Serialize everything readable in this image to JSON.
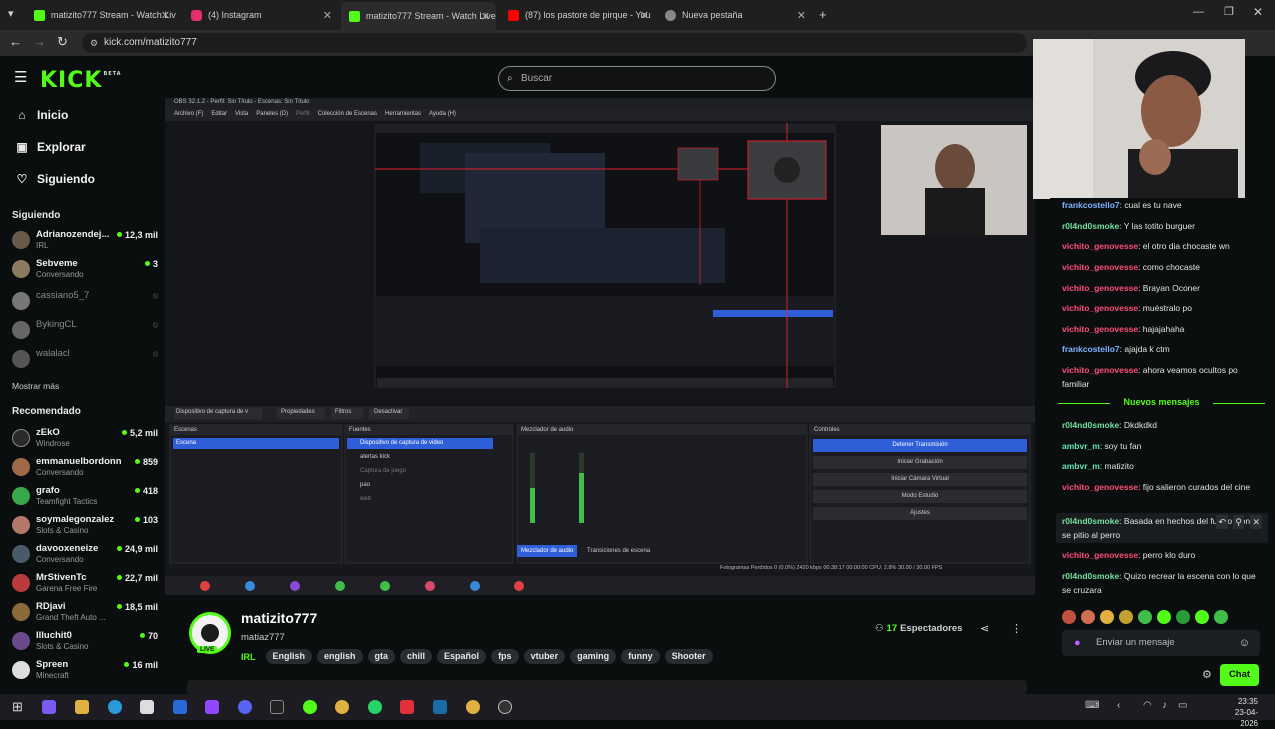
{
  "browser": {
    "tabs": [
      {
        "title": "matizito777 Stream - Watch Live",
        "fav": "#53fc18",
        "icon": "kick-icon"
      },
      {
        "title": "(4) Instagram",
        "fav": "#e1306c",
        "icon": "instagram-icon"
      },
      {
        "title": "matizito777 Stream - Watch Live",
        "fav": "#53fc18",
        "icon": "kick-icon"
      },
      {
        "title": "(87) los pastore de pirque - You",
        "fav": "#ff0000",
        "icon": "youtube-icon"
      },
      {
        "title": "Nueva pestaña",
        "fav": "#888888",
        "icon": "chrome-icon"
      }
    ],
    "url": "kick.com/matizito777"
  },
  "header": {
    "logo": "KICK",
    "logo_badge": "BETA",
    "search_placeholder": "Buscar"
  },
  "sidebar": {
    "nav": [
      {
        "label": "Inicio",
        "icon": "home-icon",
        "glyph": "⌂"
      },
      {
        "label": "Explorar",
        "icon": "compass-icon",
        "glyph": "▣"
      },
      {
        "label": "Siguiendo",
        "icon": "heart-icon",
        "glyph": "♡"
      }
    ],
    "following_title": "Siguiendo",
    "following": [
      {
        "name": "Adrianozendej...",
        "sub": "IRL",
        "viewers": "12,3 mil",
        "live": true
      },
      {
        "name": "Sebveme",
        "sub": "Conversando",
        "viewers": "3",
        "live": true
      },
      {
        "name": "cassiano5_7",
        "sub": "",
        "viewers": "",
        "live": false
      },
      {
        "name": "BykingCL",
        "sub": "",
        "viewers": "",
        "live": false
      },
      {
        "name": "walalacl",
        "sub": "",
        "viewers": "",
        "live": false
      }
    ],
    "show_more": "Mostrar más",
    "recommended_title": "Recomendado",
    "recommended": [
      {
        "name": "zEkO",
        "sub": "Windrose",
        "viewers": "5,2 mil"
      },
      {
        "name": "emmanuelbordonn",
        "sub": "Conversando",
        "viewers": "859"
      },
      {
        "name": "grafo",
        "sub": "Teamfight Tactics",
        "viewers": "418"
      },
      {
        "name": "soymalegonzalez",
        "sub": "Slots & Casino",
        "viewers": "103"
      },
      {
        "name": "davooxeneize",
        "sub": "Conversando",
        "viewers": "24,9 mil"
      },
      {
        "name": "MrStivenTc",
        "sub": "Garena Free Fire",
        "viewers": "22,7 mil"
      },
      {
        "name": "RDjavi",
        "sub": "Grand Theft Auto ...",
        "viewers": "18,5 mil"
      },
      {
        "name": "Illuchit0",
        "sub": "Slots & Casino",
        "viewers": "70"
      },
      {
        "name": "Spreen",
        "sub": "Minecraft",
        "viewers": "16 mil"
      }
    ]
  },
  "stream": {
    "obs_title": "OBS 32.1.2 - Perfil: Sin Título - Escenas: Sin Título",
    "obs_menu": [
      "Archivo (F)",
      "Editar",
      "Vista",
      "Paneles (D)",
      "Perfil",
      "Colección de Escenas",
      "Herramientas",
      "Ayuda (H)"
    ],
    "source_bar": [
      "Dispositivo de captura de v",
      "Propiedades",
      "Filtros",
      "Desactivar"
    ],
    "panels": {
      "scenes_title": "Escenas",
      "scenes": [
        "Escena"
      ],
      "sources_title": "Fuentes",
      "sources": [
        "Dispositivo de captura de video",
        "alertas kick",
        "Captura de juego",
        "pao",
        "web"
      ],
      "mixer_title": "Mezclador de audio",
      "mixer_tabs": [
        "Mezclador de audio",
        "Transiciones de escena"
      ],
      "controls_title": "Controles",
      "controls": [
        "Detener Transmisión",
        "Iniciar Grabación",
        "Iniciar Cámara Virtual",
        "Modo Estudio",
        "Ajustes"
      ]
    },
    "status": "Fotogramas Perdidos 0 (0.0%)   2420 kbps   00:38:17   00:00:00   CPU: 2.8%   30.00 / 30.00 FPS"
  },
  "streamer": {
    "name": "matizito777",
    "handle": "matiaz777",
    "live_badge": "LIVE",
    "category": "IRL",
    "tags": [
      "English",
      "english",
      "gta",
      "chill",
      "Español",
      "fps",
      "vtuber",
      "gaming",
      "funny",
      "Shooter"
    ],
    "viewers_count": "17",
    "viewers_label": "Espectadores"
  },
  "chat": {
    "messages": [
      {
        "user": "frankcostello7",
        "cls": "ufc",
        "text": "cual es tu nave"
      },
      {
        "user": "r0l4nd0smoke",
        "cls": "ur0",
        "text": "Y las totito burguer"
      },
      {
        "user": "vichito_genovesse",
        "cls": "uvg",
        "text": "el otro dia chocaste wn"
      },
      {
        "user": "vichito_genovesse",
        "cls": "uvg",
        "text": "como chocaste"
      },
      {
        "user": "vichito_genovesse",
        "cls": "uvg",
        "text": "Brayan Oconer"
      },
      {
        "user": "vichito_genovesse",
        "cls": "uvg",
        "text": "muéstralo po"
      },
      {
        "user": "vichito_genovesse",
        "cls": "uvg",
        "text": "hajajahaha"
      },
      {
        "user": "frankcostello7",
        "cls": "ufc",
        "text": "ajajda k ctm"
      },
      {
        "user": "vichito_genovesse",
        "cls": "uvg",
        "text": "ahora veamos ocultos po familiar"
      }
    ],
    "new_messages_label": "Nuevos mensajes",
    "new_messages": [
      {
        "user": "r0l4nd0smoke",
        "cls": "ur0",
        "text": "Dkdkdkd"
      },
      {
        "user": "ambvr_m",
        "cls": "uam",
        "text": "soy tu fan"
      },
      {
        "user": "ambvr_m",
        "cls": "uam",
        "text": "matizito"
      },
      {
        "user": "vichito_genovesse",
        "cls": "uvg",
        "text": "fijo salieron curados del cine"
      },
      {
        "user": "r0l4nd0smoke",
        "cls": "ur0",
        "text": "Basada en hechos del futuro won q se pitio al perro"
      },
      {
        "user": "vichito_genovesse",
        "cls": "uvg",
        "text": "perro klo duro"
      },
      {
        "user": "r0l4nd0smoke",
        "cls": "ur0",
        "text": "Quizo recrear la escena con lo que se cruzara"
      }
    ],
    "input_placeholder": "Enviar un mensaje",
    "send_label": "Chat"
  },
  "taskbar": {
    "time": "23:35",
    "date": "23-04-2026"
  }
}
